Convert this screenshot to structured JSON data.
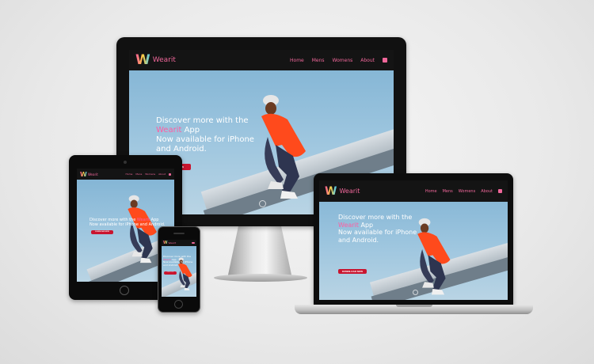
{
  "brand": {
    "logo_letter": "W",
    "name": "Wearit",
    "accent": "#f0679a",
    "button_color": "#c9152f"
  },
  "nav": {
    "home": "Home",
    "mens": "Mens",
    "womens": "Womens",
    "about": "About",
    "cart_icon": "shopping-bag-icon"
  },
  "hero": {
    "line1": "Discover more with the",
    "brand_word": "Wearit",
    "brand_word_after": "App",
    "line3": "Now available for iPhone",
    "line4": "and Android.",
    "button_label": "DOWNLOAD NOW",
    "scroll_icon": "chevron-down-icon"
  }
}
